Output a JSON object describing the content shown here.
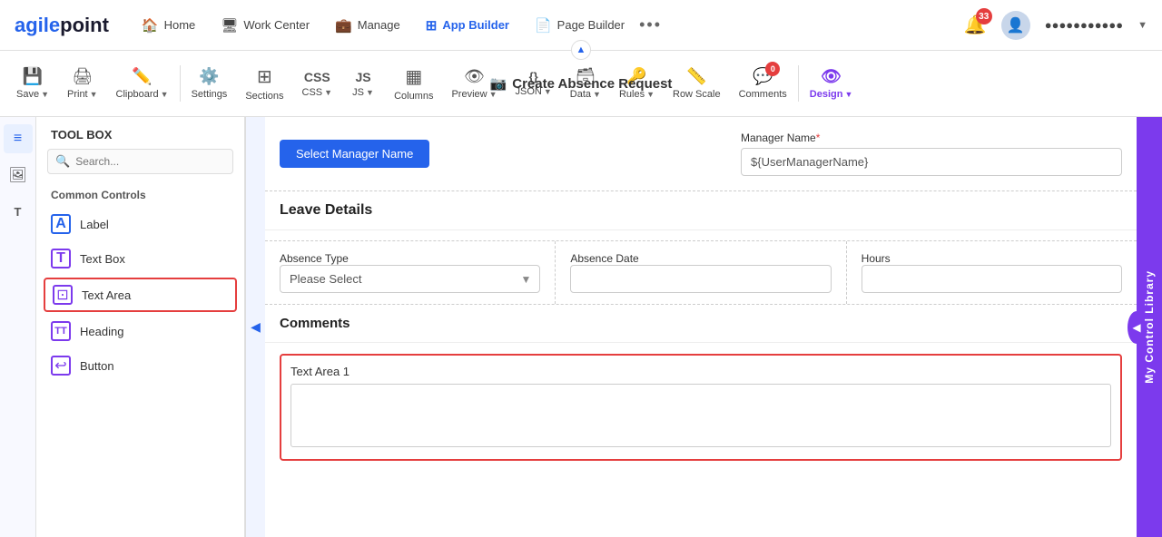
{
  "logo": {
    "text": "agilepoint"
  },
  "nav": {
    "items": [
      {
        "id": "home",
        "label": "Home",
        "icon": "🏠",
        "active": false
      },
      {
        "id": "work-center",
        "label": "Work Center",
        "active": false
      },
      {
        "id": "manage",
        "label": "Manage",
        "active": false
      },
      {
        "id": "app-builder",
        "label": "App Builder",
        "active": true
      },
      {
        "id": "page-builder",
        "label": "Page Builder",
        "active": false
      }
    ],
    "more_icon": "•••",
    "notification_count": "33",
    "user_name": "●●●●●●●●●●●"
  },
  "toolbar": {
    "title": "Create Absence Request",
    "title_icon": "📷",
    "collapse_icon": "▲",
    "items": [
      {
        "id": "save",
        "label": "Save",
        "icon": "💾",
        "has_caret": true
      },
      {
        "id": "print",
        "label": "Print",
        "icon": "🖨",
        "has_caret": true
      },
      {
        "id": "clipboard",
        "label": "Clipboard",
        "icon": "✏️",
        "has_caret": true
      },
      {
        "id": "settings",
        "label": "Settings",
        "icon": "⚙️",
        "has_caret": false
      },
      {
        "id": "sections",
        "label": "Sections",
        "icon": "⊞",
        "has_caret": false
      },
      {
        "id": "css",
        "label": "CSS",
        "icon": "📄",
        "has_caret": true
      },
      {
        "id": "js",
        "label": "JS",
        "icon": "JS",
        "has_caret": true
      },
      {
        "id": "columns",
        "label": "Columns",
        "icon": "▦",
        "has_caret": false
      },
      {
        "id": "preview",
        "label": "Preview",
        "icon": "👁",
        "has_caret": true
      },
      {
        "id": "json",
        "label": "JSON",
        "icon": "{}",
        "has_caret": true
      },
      {
        "id": "data",
        "label": "Data",
        "icon": "🗃",
        "has_caret": true
      },
      {
        "id": "rules",
        "label": "Rules",
        "icon": "🔑",
        "has_caret": true
      },
      {
        "id": "row-scale",
        "label": "Row Scale",
        "icon": "📏",
        "has_caret": false
      },
      {
        "id": "comments",
        "label": "Comments",
        "icon": "💬",
        "has_caret": false,
        "badge": "0"
      },
      {
        "id": "design",
        "label": "Design",
        "icon": "👁‍🗨",
        "has_caret": true,
        "accent": true
      }
    ]
  },
  "sidebar": {
    "icons": [
      {
        "id": "list",
        "icon": "≡",
        "active": true
      },
      {
        "id": "image",
        "icon": "🖼",
        "active": false
      },
      {
        "id": "tag",
        "icon": "T",
        "active": false
      }
    ]
  },
  "toolbox": {
    "header": "TOOL BOX",
    "search_placeholder": "Search...",
    "section_label": "Common Controls",
    "items": [
      {
        "id": "label",
        "label": "Label",
        "icon": "A"
      },
      {
        "id": "text-box",
        "label": "Text Box",
        "icon": "T",
        "selected": false
      },
      {
        "id": "text-area",
        "label": "Text Area",
        "icon": "⊡",
        "selected": true
      },
      {
        "id": "heading",
        "label": "Heading",
        "icon": "TT"
      },
      {
        "id": "button",
        "label": "Button",
        "icon": "↩"
      }
    ]
  },
  "form": {
    "select_manager_btn": "Select Manager Name",
    "manager_name_label": "Manager Name",
    "manager_name_value": "${UserManagerName}",
    "leave_details_header": "Leave Details",
    "absence_type_label": "Absence Type",
    "absence_type_placeholder": "Please Select",
    "absence_date_label": "Absence Date",
    "hours_label": "Hours",
    "comments_header": "Comments",
    "text_area_label": "Text Area 1"
  },
  "right_panel": {
    "label": "My Control Library",
    "arrow": "◀"
  }
}
